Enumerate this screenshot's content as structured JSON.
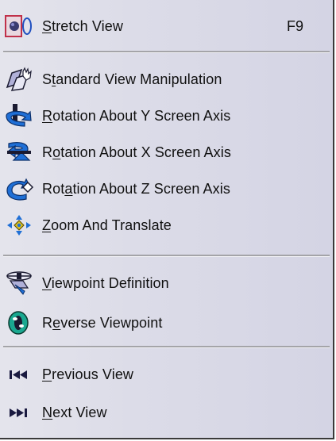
{
  "menu": {
    "items": [
      {
        "icon": "stretch-view-icon",
        "pre": "",
        "mn": "S",
        "post": "tretch View",
        "shortcut": "F9"
      },
      {
        "icon": "standard-view-manipulation-icon",
        "pre": "S",
        "mn": "t",
        "post": "andard View Manipulation",
        "shortcut": ""
      },
      {
        "icon": "rotation-y-axis-icon",
        "pre": "",
        "mn": "R",
        "post": "otation About Y Screen Axis",
        "shortcut": ""
      },
      {
        "icon": "rotation-x-axis-icon",
        "pre": "R",
        "mn": "o",
        "post": "tation About X Screen Axis",
        "shortcut": ""
      },
      {
        "icon": "rotation-z-axis-icon",
        "pre": "Rot",
        "mn": "a",
        "post": "tion About Z Screen Axis",
        "shortcut": ""
      },
      {
        "icon": "zoom-translate-icon",
        "pre": "",
        "mn": "Z",
        "post": "oom And Translate",
        "shortcut": ""
      },
      {
        "icon": "viewpoint-definition-icon",
        "pre": "",
        "mn": "V",
        "post": "iewpoint Definition",
        "shortcut": ""
      },
      {
        "icon": "reverse-viewpoint-icon",
        "pre": "R",
        "mn": "e",
        "post": "verse Viewpoint",
        "shortcut": ""
      },
      {
        "icon": "previous-view-icon",
        "pre": "",
        "mn": "P",
        "post": "revious View",
        "shortcut": ""
      },
      {
        "icon": "next-view-icon",
        "pre": "",
        "mn": "N",
        "post": "ext View",
        "shortcut": ""
      }
    ]
  },
  "colors": {
    "menu_bg": "#dcdce8",
    "icon_blue": "#1f6fd6",
    "icon_dark": "#1a1a30",
    "icon_teal": "#1aa890"
  }
}
